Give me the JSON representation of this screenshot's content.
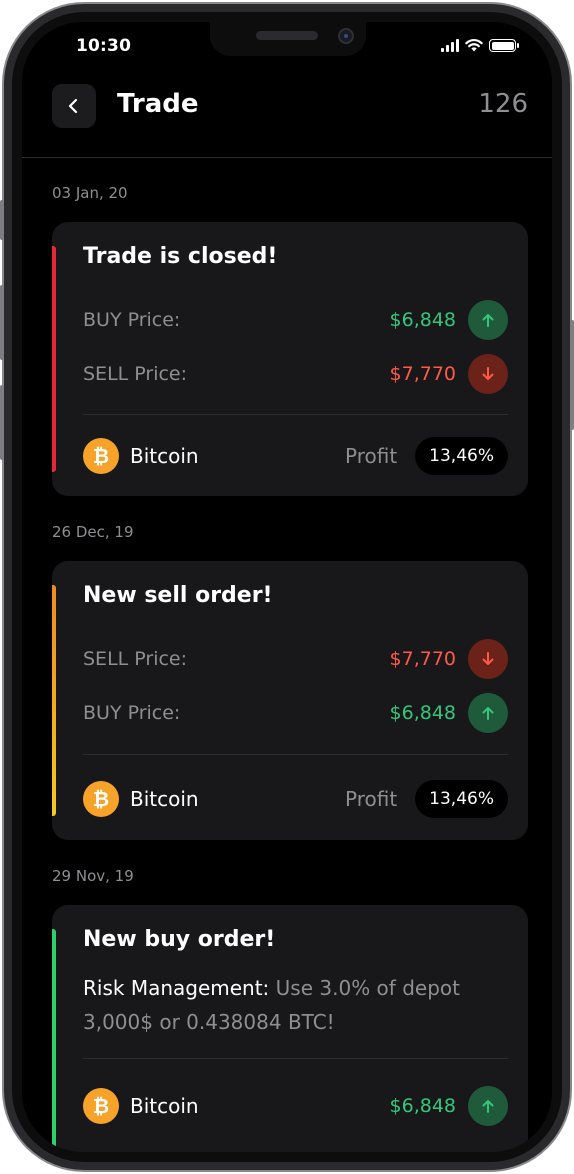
{
  "status_bar": {
    "time": "10:30"
  },
  "header": {
    "title": "Trade",
    "count": "126"
  },
  "colors": {
    "green": "#34c77b",
    "red": "#ff5a47",
    "accent_red": "#e8283a",
    "accent_yellow": "#f5b31e",
    "accent_green": "#2fcf6a",
    "btc": "#f7a32a"
  },
  "trades": [
    {
      "date": "03 Jan, 20",
      "title": "Trade is closed!",
      "rows": [
        {
          "label": "BUY Price:",
          "value": "$6,848",
          "direction": "up"
        },
        {
          "label": "SELL Price:",
          "value": "$7,770",
          "direction": "down"
        }
      ],
      "coin": "Bitcoin",
      "profit_label": "Profit",
      "profit_value": "13,46%"
    },
    {
      "date": "26 Dec, 19",
      "title": "New sell order!",
      "rows": [
        {
          "label": "SELL Price:",
          "value": "$7,770",
          "direction": "down"
        },
        {
          "label": "BUY Price:",
          "value": "$6,848",
          "direction": "up"
        }
      ],
      "coin": "Bitcoin",
      "profit_label": "Profit",
      "profit_value": "13,46%"
    },
    {
      "date": "29 Nov, 19",
      "title": "New buy order!",
      "risk_label": "Risk Management:",
      "risk_text": "Use 3.0% of depot 3,000$ or 0.438084 BTC!",
      "coin": "Bitcoin",
      "price": "$6,848",
      "direction": "up"
    }
  ]
}
